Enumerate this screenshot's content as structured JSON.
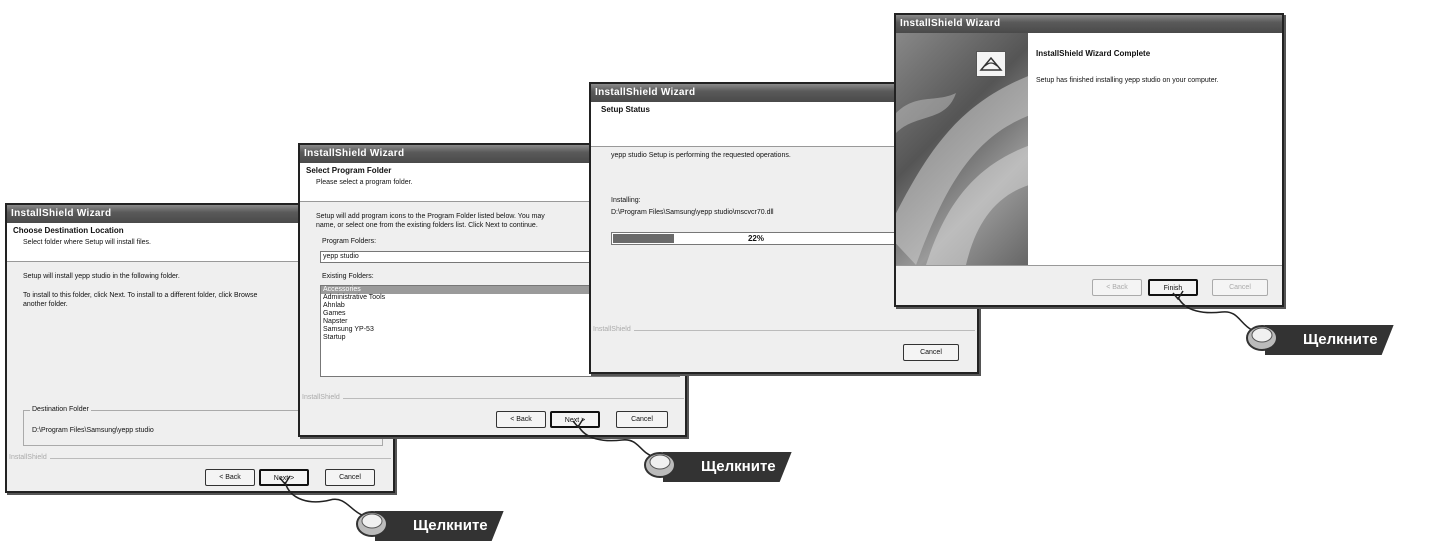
{
  "wizards": [
    {
      "title": "InstallShield Wizard",
      "header_title": "Choose Destination Location",
      "header_subtitle": "Select folder where Setup will install files.",
      "body_line1": "Setup will install yepp studio in the following folder.",
      "body_line2": "To install to this folder, click Next. To install to a different folder, click Browse",
      "body_line3": "another folder.",
      "group_label": "Destination Folder",
      "destination_path": "D:\\Program Files\\Samsung\\yepp studio",
      "brand": "InstallShield",
      "buttons": {
        "back": "< Back",
        "next": "Next >",
        "cancel": "Cancel"
      }
    },
    {
      "title": "InstallShield Wizard",
      "header_title": "Select Program Folder",
      "header_subtitle": "Please select a program folder.",
      "body_line1": "Setup will add program icons to the Program Folder listed below.  You may",
      "body_line2": "name, or select one from the existing folders list.  Click Next to continue.",
      "program_folders_label": "Program Folders:",
      "program_folder_value": "yepp studio",
      "existing_folders_label": "Existing Folders:",
      "existing_folders": [
        "Accessories",
        "Administrative Tools",
        "Ahnlab",
        "Games",
        "Napster",
        "Samsung YP-53",
        "Startup"
      ],
      "brand": "InstallShield",
      "buttons": {
        "back": "< Back",
        "next": "Next >",
        "cancel": "Cancel"
      }
    },
    {
      "title": "InstallShield Wizard",
      "header_title": "Setup Status",
      "status_text": "yepp studio Setup is performing the requested operations.",
      "installing_label": "Installing:",
      "installing_file": "D:\\Program Files\\Samsung\\yepp studio\\mscvcr70.dll",
      "progress_percent": 22,
      "progress_label": "22%",
      "brand": "InstallShield",
      "buttons": {
        "cancel": "Cancel"
      }
    },
    {
      "title": "InstallShield Wizard",
      "complete_title": "InstallShield Wizard Complete",
      "complete_text": "Setup has finished installing yepp studio on your computer.",
      "buttons": {
        "back": "< Back",
        "finish": "Finish",
        "cancel": "Cancel"
      }
    }
  ],
  "callouts": [
    "Щелкните",
    "Щелкните",
    "Щелкните"
  ]
}
